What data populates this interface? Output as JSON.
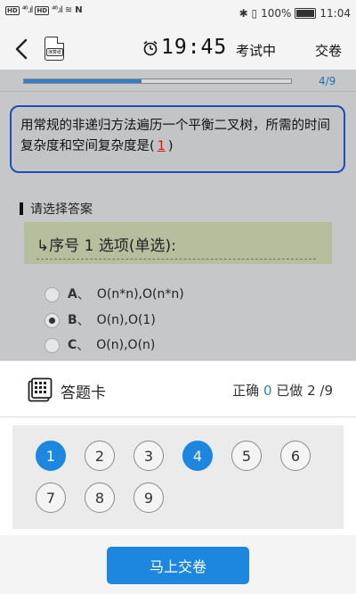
{
  "status_bar": {
    "hd1": "HD",
    "hd2": "HD",
    "signal1": "⁴⁶.ıl",
    "signal2": "⁴⁶.ıl",
    "wifi": "≋",
    "nfc": "N",
    "icons_right": "✱ ▯",
    "battery_percent": "100%",
    "time": "11:04"
  },
  "header": {
    "doc_icon_text": "演算纸",
    "timer": "19:45",
    "status": "考试中",
    "submit": "交卷"
  },
  "progress": {
    "text": "4/9",
    "fraction": 0.44
  },
  "question": {
    "text": "用常规的非递归方法遍历一个平衡二叉树，所需的时间复杂度和空间复杂度是(",
    "blank": "1",
    "suffix": ")"
  },
  "choose_title": "请选择答案",
  "answer_type": "↳序号 1 选项(单选):",
  "options": [
    {
      "letter": "A",
      "sep": "、",
      "text": "O(n*n),O(n*n)",
      "checked": false
    },
    {
      "letter": "B",
      "sep": "、",
      "text": "O(n),O(1)",
      "checked": true
    },
    {
      "letter": "C",
      "sep": "、",
      "text": "O(n),O(n)",
      "checked": false
    }
  ],
  "answer_card": {
    "label": "答题卡",
    "correct_label": "正确",
    "correct_count": "0",
    "done_label": "已做",
    "done_count": "2 /9"
  },
  "numbers": [
    {
      "n": "1",
      "done": true
    },
    {
      "n": "2",
      "done": false
    },
    {
      "n": "3",
      "done": false
    },
    {
      "n": "4",
      "done": true
    },
    {
      "n": "5",
      "done": false
    },
    {
      "n": "6",
      "done": false
    },
    {
      "n": "7",
      "done": false
    },
    {
      "n": "8",
      "done": false
    },
    {
      "n": "9",
      "done": false
    }
  ],
  "submit_button": "马上交卷",
  "colors": {
    "accent": "#1d86de",
    "question_border": "#1c4eb8",
    "blank": "#d11111"
  }
}
